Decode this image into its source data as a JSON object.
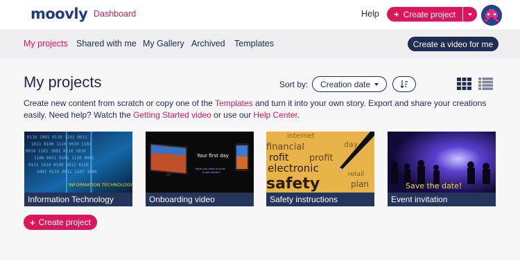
{
  "header": {
    "logo": "moovly",
    "dashboard_link": "Dashboard",
    "help_link": "Help",
    "create_project": "Create project"
  },
  "nav": {
    "tabs": [
      {
        "label": "My projects",
        "active": true
      },
      {
        "label": "Shared with me",
        "active": false
      },
      {
        "label": "My Gallery",
        "active": false
      },
      {
        "label": "Archived",
        "active": false
      },
      {
        "label": "Templates",
        "active": false
      }
    ],
    "create_video": "Create a video for me"
  },
  "main": {
    "title": "My projects",
    "sort_label": "Sort by:",
    "sort_value": "Creation date",
    "description": {
      "part1": "Create new content from scratch or copy one of the ",
      "link1": "Templates",
      "part2": " and turn it into your own story. Export and share your creations easily. Need help? Watch the ",
      "link2": "Getting Started video",
      "part3": " or use our ",
      "link3": "Help Center",
      "part4": "."
    },
    "projects": [
      {
        "title": "Information Technology",
        "thumb_text": "INFORMATION TECHNOLOGY"
      },
      {
        "title": "Onboarding video",
        "thumb_text": "Your first day",
        "thumb_subtext": "What you need to know to get started"
      },
      {
        "title": "Safety instructions",
        "thumb_words": [
          "internet",
          "financial",
          "day",
          "profit",
          "electronic",
          "safety",
          "retail",
          "plan"
        ]
      },
      {
        "title": "Event invitation",
        "thumb_text": "Save the date!"
      }
    ],
    "create_project_bottom": "Create project"
  },
  "colors": {
    "accent": "#d8185a",
    "navy": "#1f2d52",
    "nav_bg": "#eeeef0",
    "main_bg": "#f7f7f8"
  }
}
